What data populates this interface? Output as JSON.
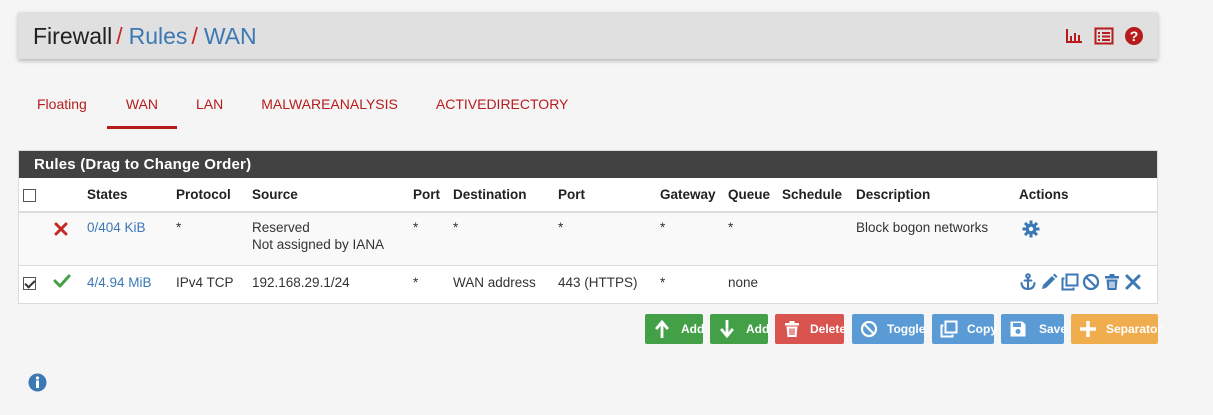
{
  "breadcrumb": {
    "root": "Firewall",
    "rules": "Rules",
    "current": "WAN",
    "separator": "/"
  },
  "header_icons": [
    "bar-chart-icon",
    "list-icon",
    "help-icon"
  ],
  "tabs": [
    {
      "label": "Floating",
      "active": false
    },
    {
      "label": "WAN",
      "active": true
    },
    {
      "label": "LAN",
      "active": false
    },
    {
      "label": "MALWAREANALYSIS",
      "active": false
    },
    {
      "label": "ACTIVEDIRECTORY",
      "active": false
    }
  ],
  "panel": {
    "title": "Rules (Drag to Change Order)"
  },
  "table": {
    "headers": {
      "states": "States",
      "protocol": "Protocol",
      "source": "Source",
      "port": "Port",
      "destination": "Destination",
      "dest_port": "Port",
      "gateway": "Gateway",
      "queue": "Queue",
      "schedule": "Schedule",
      "description": "Description",
      "actions": "Actions"
    },
    "rows": [
      {
        "checked": null,
        "status": "block",
        "states": "0/404 KiB",
        "protocol": "*",
        "source_line1": "Reserved",
        "source_line2": "Not assigned by IANA",
        "port": "*",
        "destination": "*",
        "dest_port": "*",
        "gateway": "*",
        "queue": "*",
        "schedule": "",
        "description": "Block bogon networks"
      },
      {
        "checked": true,
        "status": "pass",
        "states": "4/4.94 MiB",
        "protocol": "IPv4 TCP",
        "source": "192.168.29.1/24",
        "port": "*",
        "destination": "WAN address",
        "dest_port": "443 (HTTPS)",
        "gateway": "*",
        "queue": "none",
        "schedule": "",
        "description": ""
      }
    ]
  },
  "buttons": {
    "add_top": "Add",
    "add_bottom": "Add",
    "delete": "Delete",
    "toggle": "Toggle",
    "copy": "Copy",
    "save": "Save",
    "separator": "Separator"
  },
  "colors": {
    "accent_red": "#b71c1c",
    "link_blue": "#3c78b4",
    "panel_heading": "#424242",
    "button_green": "#43a047",
    "button_red": "#d9534f",
    "button_blue": "#5b9bd5",
    "button_orange": "#f0ad4e"
  }
}
